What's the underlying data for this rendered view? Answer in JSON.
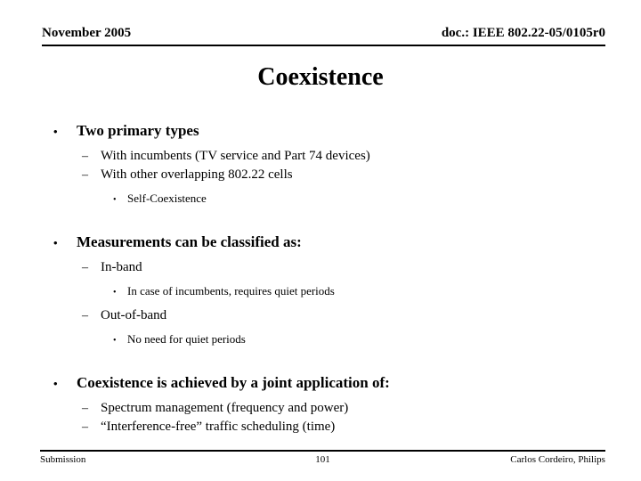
{
  "header": {
    "left": "November 2005",
    "right": "doc.: IEEE 802.22-05/0105r0"
  },
  "title": "Coexistence",
  "bullets": {
    "b1": {
      "mark": "•",
      "text": "Two primary types"
    },
    "b1a": {
      "mark": "–",
      "text": "With incumbents (TV service and Part 74 devices)"
    },
    "b1b": {
      "mark": "–",
      "text": "With other overlapping 802.22 cells"
    },
    "b1b1": {
      "mark": "•",
      "text": "Self-Coexistence"
    },
    "b2": {
      "mark": "•",
      "text": "Measurements can be classified as:"
    },
    "b2a": {
      "mark": "–",
      "text": "In-band"
    },
    "b2a1": {
      "mark": "•",
      "text": "In case of incumbents, requires quiet periods"
    },
    "b2b": {
      "mark": "–",
      "text": "Out-of-band"
    },
    "b2b1": {
      "mark": "•",
      "text": "No need for quiet periods"
    },
    "b3": {
      "mark": "•",
      "text": "Coexistence is achieved by a joint application of:"
    },
    "b3a": {
      "mark": "–",
      "text": "Spectrum management (frequency and power)"
    },
    "b3b": {
      "mark": "–",
      "text": "“Interference-free” traffic scheduling (time)"
    }
  },
  "footer": {
    "left": "Submission",
    "page": "101",
    "right": "Carlos Cordeiro, Philips"
  },
  "colors": {
    "text": "#000000",
    "background": "#ffffff",
    "rule": "#000000"
  }
}
